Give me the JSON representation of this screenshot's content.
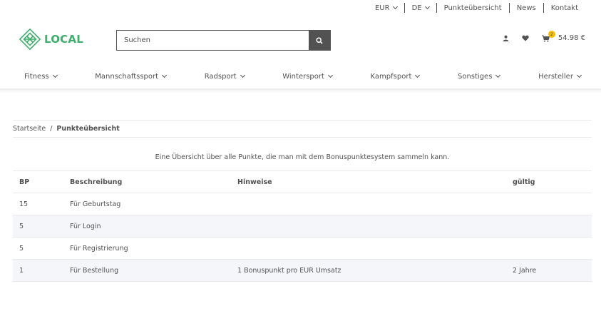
{
  "topbar": {
    "currency": "EUR",
    "language": "DE",
    "links": [
      "Punkteübersicht",
      "News",
      "Kontakt"
    ]
  },
  "logo": {
    "text": "LOCAL",
    "icon": "diamond-leaf-logo-icon",
    "color": "#3fae6c"
  },
  "search": {
    "placeholder": "Suchen",
    "icon": "search-icon"
  },
  "header_icons": {
    "account_icon": "user-icon",
    "wishlist_icon": "heart-icon",
    "cart_icon": "cart-icon",
    "cart_count": "2",
    "cart_total": "54.98 €",
    "badge_color": "#f8bf00"
  },
  "categories": [
    "Fitness",
    "Mannschaftssport",
    "Radsport",
    "Wintersport",
    "Kampfsport",
    "Sonstiges",
    "Hersteller"
  ],
  "breadcrumb": {
    "home": "Startseite",
    "separator": "/",
    "current": "Punkteübersicht"
  },
  "intro": "Eine Übersicht über alle Punkte, die man mit dem Bonuspunktesystem sammeln kann.",
  "table": {
    "headers": [
      "BP",
      "Beschreibung",
      "Hinweise",
      "gültig"
    ],
    "rows": [
      [
        "15",
        "Für Geburtstag",
        "",
        ""
      ],
      [
        "5",
        "Für Login",
        "",
        ""
      ],
      [
        "5",
        "Für Registrierung",
        "",
        ""
      ],
      [
        "1",
        "Für Bestellung",
        "1 Bonuspunkt pro EUR Umsatz",
        "2 Jahre"
      ]
    ]
  }
}
